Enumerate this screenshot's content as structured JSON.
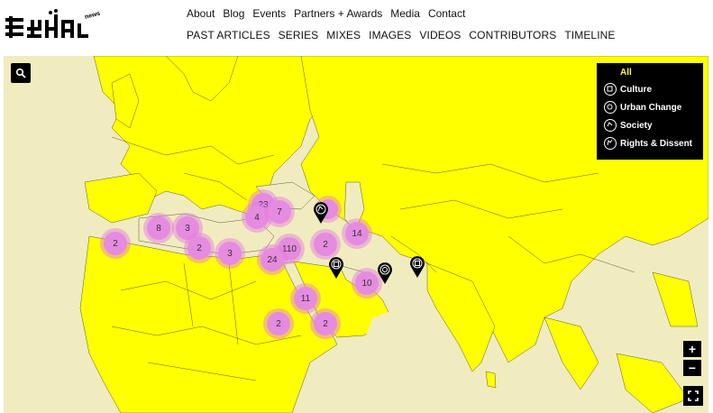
{
  "brand": {
    "logo_text": "MASHALLAH",
    "logo_suffix": "news"
  },
  "nav_primary": [
    {
      "label": "About"
    },
    {
      "label": "Blog"
    },
    {
      "label": "Events"
    },
    {
      "label": "Partners + Awards"
    },
    {
      "label": "Media"
    },
    {
      "label": "Contact"
    }
  ],
  "nav_secondary": [
    {
      "label": "PAST ARTICLES"
    },
    {
      "label": "SERIES"
    },
    {
      "label": "MIXES"
    },
    {
      "label": "IMAGES"
    },
    {
      "label": "VIDEOS"
    },
    {
      "label": "CONTRIBUTORS"
    },
    {
      "label": "TIMELINE"
    }
  ],
  "map": {
    "land_color": "#ffff00",
    "sea_color": "#f1ecbf",
    "cluster_color": "#e58be0",
    "legend": {
      "all_label": "All",
      "items": [
        {
          "label": "Culture",
          "icon": "culture-icon"
        },
        {
          "label": "Urban Change",
          "icon": "urban-change-icon"
        },
        {
          "label": "Society",
          "icon": "society-icon"
        },
        {
          "label": "Rights & Dissent",
          "icon": "rights-dissent-icon"
        }
      ]
    },
    "clusters": [
      {
        "count": "23"
      },
      {
        "count": "4"
      },
      {
        "count": "7"
      },
      {
        "count": "8"
      },
      {
        "count": "3"
      },
      {
        "count": "2"
      },
      {
        "count": "2"
      },
      {
        "count": "3"
      },
      {
        "count": "110"
      },
      {
        "count": "24"
      },
      {
        "count": "2"
      },
      {
        "count": "14"
      },
      {
        "count": "11"
      },
      {
        "count": "10"
      },
      {
        "count": "2"
      },
      {
        "count": "2"
      }
    ],
    "zoom_in": "+",
    "zoom_out": "−"
  }
}
